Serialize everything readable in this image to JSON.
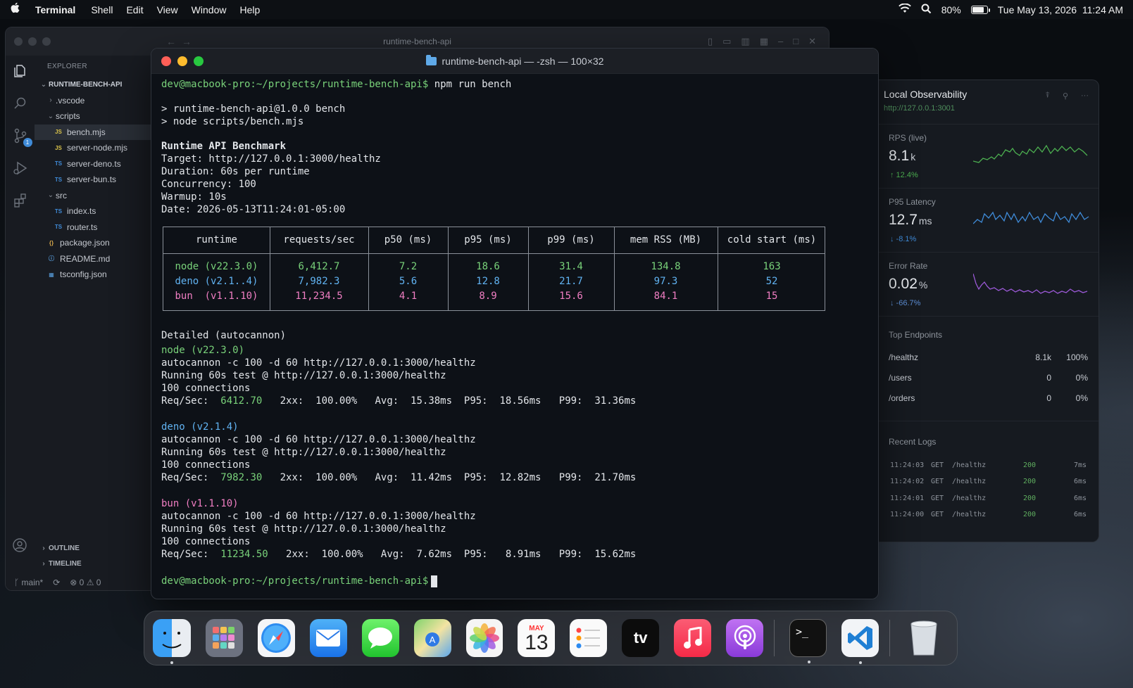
{
  "menubar": {
    "app": "Terminal",
    "menus": [
      "Shell",
      "Edit",
      "View",
      "Window",
      "Help"
    ],
    "battery": "80%",
    "datetime": "Tue May 13, 2026  11:24 AM"
  },
  "vscode": {
    "title": "runtime-bench-api",
    "explorer_label": "EXPLORER",
    "project": "RUNTIME-BENCH-API",
    "tree": [
      {
        "kind": "folder",
        "name": ".vscode",
        "open": false,
        "indent": 1
      },
      {
        "kind": "folder",
        "name": "scripts",
        "open": true,
        "indent": 1
      },
      {
        "kind": "file",
        "type": "JS",
        "name": "bench.mjs",
        "indent": 2,
        "selected": true
      },
      {
        "kind": "file",
        "type": "JS",
        "name": "server-node.mjs",
        "indent": 2
      },
      {
        "kind": "file",
        "type": "TS",
        "name": "server-deno.ts",
        "indent": 2
      },
      {
        "kind": "file",
        "type": "TS",
        "name": "server-bun.ts",
        "indent": 2
      },
      {
        "kind": "folder",
        "name": "src",
        "open": true,
        "indent": 1
      },
      {
        "kind": "file",
        "type": "TS",
        "name": "index.ts",
        "indent": 2
      },
      {
        "kind": "file",
        "type": "TS",
        "name": "router.ts",
        "indent": 2
      },
      {
        "kind": "file",
        "type": "{}",
        "name": "package.json",
        "indent": 1
      },
      {
        "kind": "file",
        "type": "ⓘ",
        "name": "README.md",
        "indent": 1
      },
      {
        "kind": "file",
        "type": "▦",
        "name": "tsconfig.json",
        "indent": 1
      }
    ],
    "outline_label": "OUTLINE",
    "timeline_label": "TIMELINE",
    "status_branch": "main*",
    "status_problems": "⊗ 0 ⚠ 0",
    "scm_badge": "1"
  },
  "terminal": {
    "title": "runtime-bench-api — -zsh — 100×32",
    "prompt": "dev@macbook-pro:~/projects/runtime-bench-api$",
    "command": "npm run bench",
    "npm_lines": [
      "> runtime-bench-api@1.0.0 bench",
      "> node scripts/bench.mjs"
    ],
    "heading": "Runtime API Benchmark",
    "meta": [
      "Target: http://127.0.0.1:3000/healthz",
      "Duration: 60s per runtime",
      "Concurrency: 100",
      "Warmup: 10s",
      "Date: 2026-05-13T11:24:01-05:00"
    ],
    "table": {
      "headers": [
        "runtime",
        "requests/sec",
        "p50 (ms)",
        "p95 (ms)",
        "p99 (ms)",
        "mem RSS (MB)",
        "cold start (ms)"
      ],
      "rows": [
        {
          "color": "#79d27a",
          "cells": [
            "node (v22.3.0)",
            "6,412.7",
            "7.2",
            "18.6",
            "31.4",
            "134.8",
            "163"
          ]
        },
        {
          "color": "#61b3f2",
          "cells": [
            "deno (v2.1..4)",
            "7,982.3",
            "5.6",
            "12.8",
            "21.7",
            "97.3",
            "52"
          ]
        },
        {
          "color": "#f07ec3",
          "cells": [
            "bun  (v1.1.10)",
            "11,234.5",
            "4.1",
            "8.9",
            "15.6",
            "84.1",
            "15"
          ]
        }
      ]
    },
    "detail_heading": "Detailed (autocannon)",
    "details": [
      {
        "name": "node (v22.3.0)",
        "cmd": "autocannon -c 100 -d 60 http://127.0.0.1:3000/healthz",
        "running": "Running 60s test @ http://127.0.0.1:3000/healthz",
        "conns": "100 connections",
        "req_label": "Req/Sec:",
        "req_value": "6412.70",
        "stats": "2xx:  100.00%   Avg:  15.38ms  P95:  18.56ms   P99:  31.36ms"
      },
      {
        "name": "deno (v2.1.4)",
        "cmd": "autocannon -c 100 -d 60 http://127.0.0.1:3000/healthz",
        "running": "Running 60s test @ http://127.0.0.1:3000/healthz",
        "conns": "100 connections",
        "req_label": "Req/Sec:",
        "req_value": "7982.30",
        "stats": "2xx:  100.00%   Avg:  11.42ms  P95:  12.82ms   P99:  21.70ms"
      },
      {
        "name": "bun (v1.1.10)",
        "cmd": "autocannon -c 100 -d 60 http://127.0.0.1:3000/healthz",
        "running": "Running 60s test @ http://127.0.0.1:3000/healthz",
        "conns": "100 connections",
        "req_label": "Req/Sec:",
        "req_value": "11234.50",
        "stats": "2xx:  100.00%   Avg:  7.62ms  P95:   8.91ms   P99:  15.62ms"
      }
    ]
  },
  "observability": {
    "title": "Local Observability",
    "url": "http://127.0.0.1:3001",
    "metrics": [
      {
        "label": "RPS (live)",
        "value": "8.1",
        "unit": "k",
        "delta": "↑ 12.4%",
        "color": "#4caf50"
      },
      {
        "label": "P95 Latency",
        "value": "12.7",
        "unit": "ms",
        "delta": "↓ -8.1%",
        "color": "#3f8bd8"
      },
      {
        "label": "Error Rate",
        "value": "0.02",
        "unit": "%",
        "delta": "↓ -66.7%",
        "color": "#9b59d6"
      }
    ],
    "endpoints_title": "Top Endpoints",
    "endpoints": [
      {
        "path": "/healthz",
        "count": "8.1k",
        "pct": "100%"
      },
      {
        "path": "/users",
        "count": "0",
        "pct": "0%"
      },
      {
        "path": "/orders",
        "count": "0",
        "pct": "0%"
      }
    ],
    "logs_title": "Recent Logs",
    "logs": [
      {
        "time": "11:24:03",
        "method": "GET",
        "path": "/healthz",
        "status": "200",
        "dur": "7ms"
      },
      {
        "time": "11:24:02",
        "method": "GET",
        "path": "/healthz",
        "status": "200",
        "dur": "6ms"
      },
      {
        "time": "11:24:01",
        "method": "GET",
        "path": "/healthz",
        "status": "200",
        "dur": "6ms"
      },
      {
        "time": "11:24:00",
        "method": "GET",
        "path": "/healthz",
        "status": "200",
        "dur": "6ms"
      }
    ]
  },
  "dock": {
    "calendar_month": "MAY",
    "calendar_day": "13",
    "tv_label": "tv",
    "terminal_glyph": ">_"
  }
}
